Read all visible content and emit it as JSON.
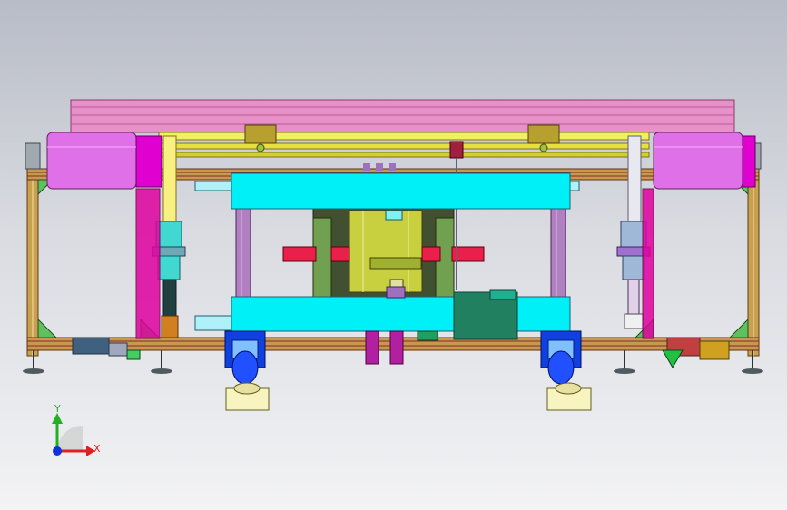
{
  "triad": {
    "x_label": "X",
    "y_label": "Y",
    "x_color": "#e02020",
    "y_color": "#20b020",
    "z_color": "#1030e0"
  },
  "colors": {
    "frame": "#c8a050",
    "top_plate": "#e890c8",
    "motor": "#e070e8",
    "platen": "#00f0f8",
    "column": "#b080c0",
    "cylinder": "#c8d040",
    "red_bar": "#e8204a",
    "rail": "#f0f060",
    "roller": "#1040e0",
    "base_block": "#f8f4c0"
  }
}
